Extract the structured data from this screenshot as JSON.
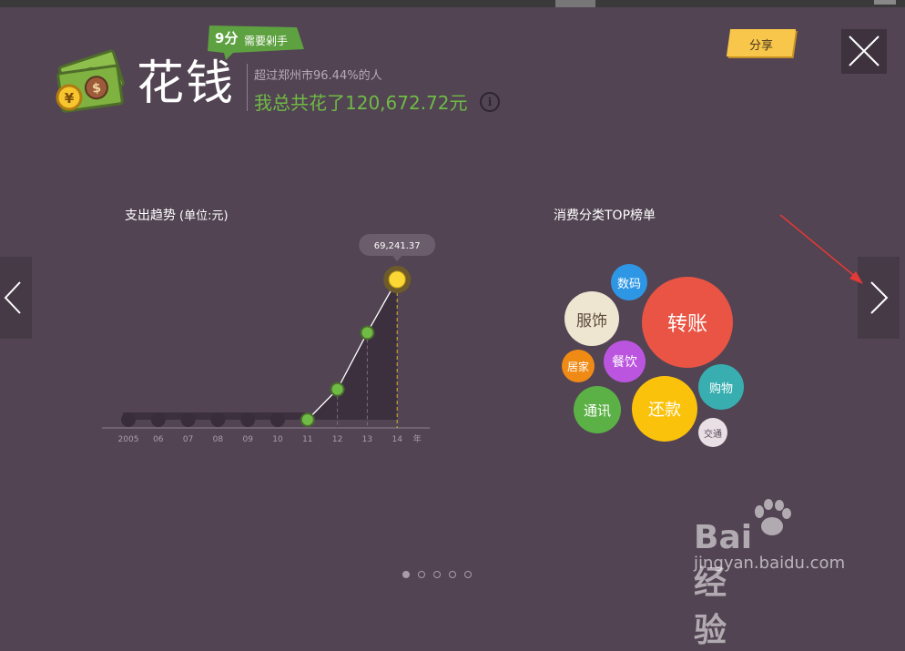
{
  "header": {
    "score": "9分",
    "score_label": "需要剁手",
    "title": "花钱",
    "subtext": "超过郑州市96.44%的人",
    "total": "我总共花了120,672.72元",
    "info_icon": "info-icon",
    "share_label": "分享",
    "close_icon": "close-icon"
  },
  "colors": {
    "background": "#524453",
    "accent_green": "#6fbb45",
    "highlight_yellow": "#fdd835",
    "share_yellow": "#f8c64a"
  },
  "chart_data": [
    {
      "type": "line",
      "title": "支出趋势",
      "unit_label": "(单位:元)",
      "x": [
        "2005",
        "06",
        "07",
        "08",
        "09",
        "10",
        "11",
        "12",
        "13",
        "14"
      ],
      "x_unit": "年",
      "values": [
        0,
        0,
        0,
        0,
        0,
        0,
        0,
        15000,
        43000,
        69241.37
      ],
      "highlight": {
        "index": 9,
        "label": "69,241.37"
      },
      "ylim": [
        0,
        69241.37
      ],
      "grid": false
    },
    {
      "type": "bubble",
      "title": "消费分类TOP榜单",
      "categories": [
        {
          "name": "转账",
          "rank": 1,
          "color": "#ea5444"
        },
        {
          "name": "还款",
          "rank": 2,
          "color": "#fbc20b"
        },
        {
          "name": "服饰",
          "rank": 3,
          "color": "#efe6d1"
        },
        {
          "name": "通讯",
          "rank": 4,
          "color": "#5cb146"
        },
        {
          "name": "餐饮",
          "rank": 5,
          "color": "#bb55e0"
        },
        {
          "name": "购物",
          "rank": 6,
          "color": "#38aeb0"
        },
        {
          "name": "数码",
          "rank": 7,
          "color": "#2e97e5"
        },
        {
          "name": "居家",
          "rank": 8,
          "color": "#ef8a15"
        },
        {
          "name": "交通",
          "rank": 9,
          "color": "#e8e0e4"
        }
      ]
    }
  ],
  "pagination": {
    "count": 5,
    "active": 0
  },
  "watermark": {
    "brand": "Bai 经验",
    "url": "jingyan.baidu.com"
  }
}
